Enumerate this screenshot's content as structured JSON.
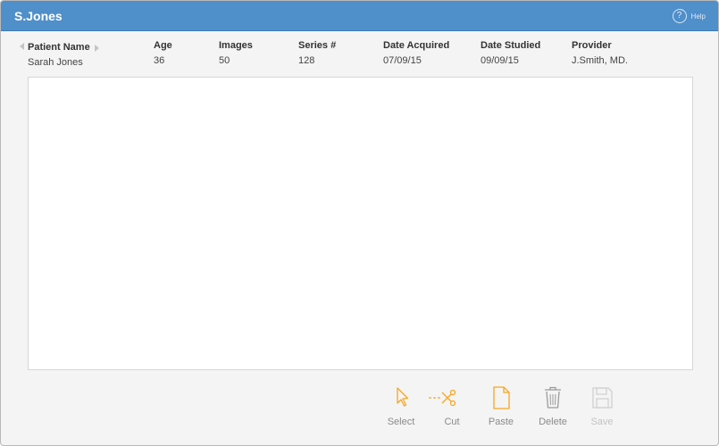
{
  "window": {
    "title": "S.Jones",
    "help_label": "Help",
    "help_glyph": "?"
  },
  "patient": {
    "headers": {
      "name": "Patient Name",
      "age": "Age",
      "images": "Images",
      "series": "Series #",
      "date_acquired": "Date Acquired",
      "date_studied": "Date Studied",
      "provider": "Provider"
    },
    "values": {
      "name": "Sarah Jones",
      "age": "36",
      "images": "50",
      "series": "128",
      "date_acquired": "07/09/15",
      "date_studied": "09/09/15",
      "provider": "J.Smith, MD."
    }
  },
  "toolbar": {
    "select_label": "Select",
    "cut_label": "Cut",
    "paste_label": "Paste",
    "delete_label": "Delete",
    "save_label": "Save"
  },
  "colors": {
    "titlebar": "#4f8fca",
    "accent_orange": "#f5a623",
    "icon_gray": "#9b9b9b",
    "icon_disabled": "#cfcfcf"
  }
}
